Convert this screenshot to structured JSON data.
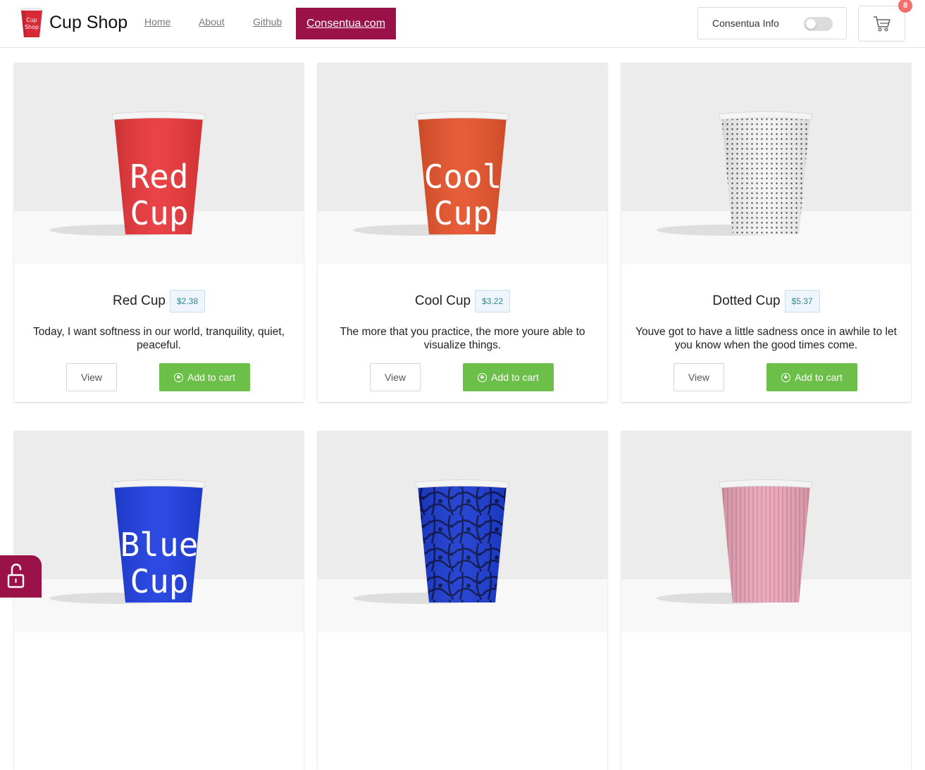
{
  "header": {
    "brand": "Cup Shop",
    "logo_text_line1": "Cup",
    "logo_text_line2": "Shop",
    "nav": {
      "home": "Home",
      "about": "About",
      "github": "Github",
      "consentua": "Consentua.com"
    },
    "consent_toggle_label": "Consentua Info",
    "consent_toggle_on": false,
    "cart_count": "8",
    "accent_color": "#9b1248"
  },
  "products": [
    {
      "name": "Red Cup",
      "price": "$2.38",
      "description": "Today, I want softness in our world, tranquility, quiet, peaceful.",
      "cup_text": [
        "Red",
        "Cup"
      ],
      "cup_color": "#e8373a",
      "view_label": "View",
      "add_label": "Add to cart"
    },
    {
      "name": "Cool Cup",
      "price": "$3.22",
      "description": "The more that you practice, the more youre able to visualize things.",
      "cup_text": [
        "Cool",
        "Cup"
      ],
      "cup_color": "#e5532c",
      "view_label": "View",
      "add_label": "Add to cart"
    },
    {
      "name": "Dotted Cup",
      "price": "$5.37",
      "description": "Youve got to have a little sadness once in awhile to let you know when the good times come.",
      "cup_text": [],
      "cup_color": "#f2f2f2",
      "view_label": "View",
      "add_label": "Add to cart"
    },
    {
      "cup_text": [
        "Blue",
        "Cup"
      ],
      "cup_color": "#1f3fe0"
    },
    {
      "cup_text": [],
      "cup_color": "#1a35c9"
    },
    {
      "cup_text": [],
      "cup_color": "#e8a6b8"
    }
  ]
}
